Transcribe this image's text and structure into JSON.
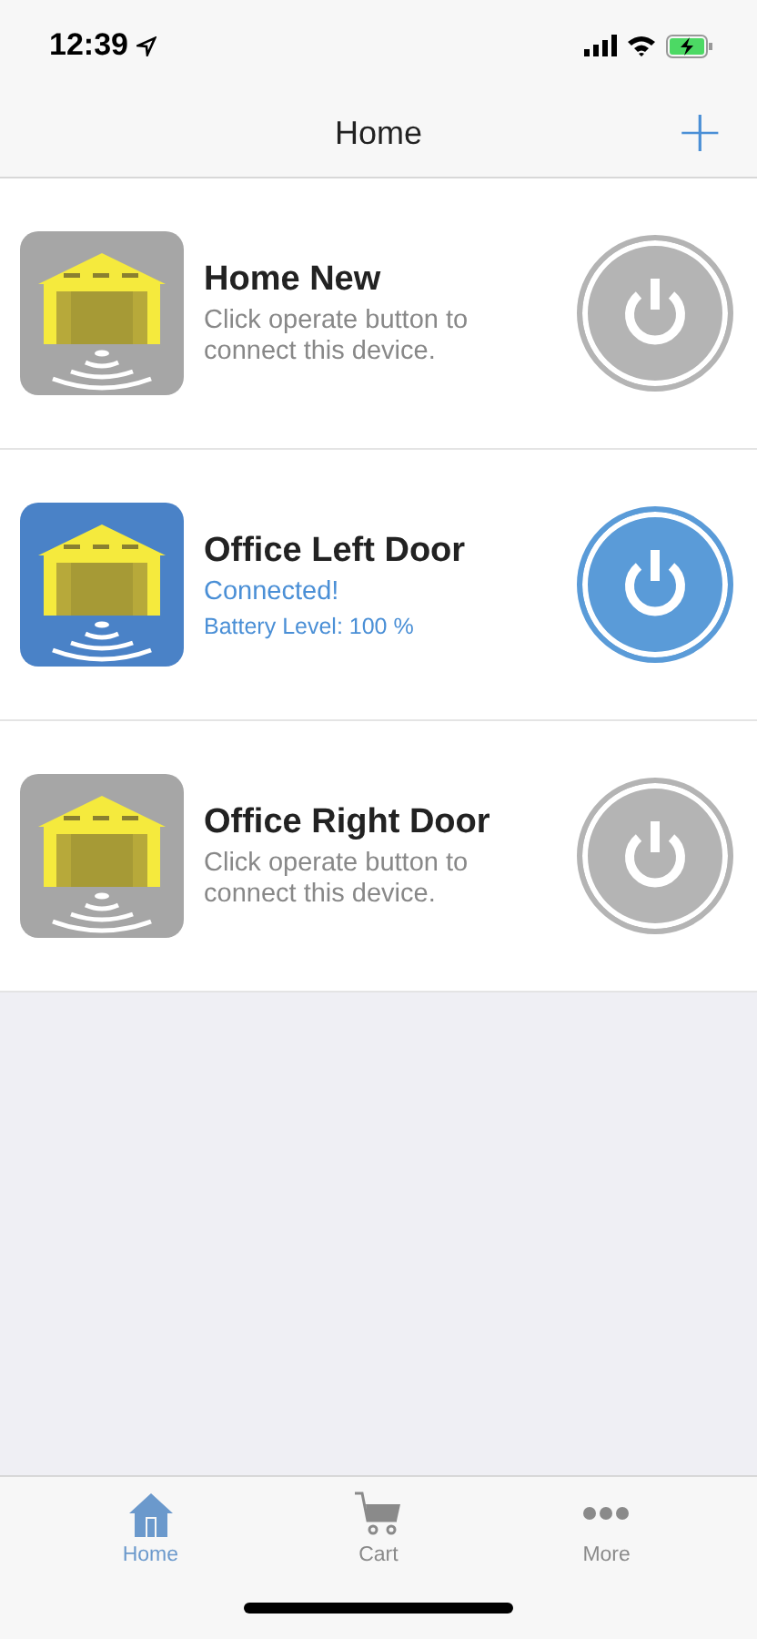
{
  "status_bar": {
    "time": "12:39"
  },
  "nav": {
    "title": "Home",
    "action": "+"
  },
  "devices": [
    {
      "name": "Home New",
      "connected": false,
      "status": "Click operate button to connect this device."
    },
    {
      "name": "Office Left Door",
      "connected": true,
      "status": "Connected!",
      "battery": "Battery Level: 100 %"
    },
    {
      "name": "Office Right Door",
      "connected": false,
      "status": "Click operate button to connect this device."
    }
  ],
  "tabs": [
    {
      "kind": "home",
      "label": "Home",
      "selected": true
    },
    {
      "kind": "cart",
      "label": "Cart",
      "selected": false
    },
    {
      "kind": "more",
      "label": "More",
      "selected": false
    }
  ]
}
